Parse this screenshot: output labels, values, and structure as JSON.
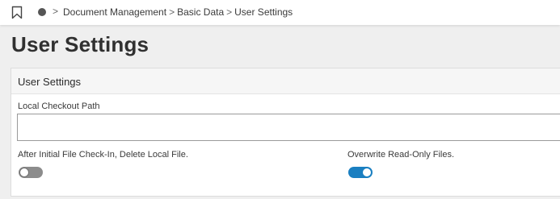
{
  "breadcrumb": {
    "items": [
      "Document Management",
      "Basic Data",
      "User Settings"
    ],
    "separator": ">"
  },
  "page": {
    "title": "User Settings"
  },
  "panel": {
    "title": "User Settings",
    "checkout_path": {
      "label": "Local Checkout Path",
      "value": "",
      "placeholder": ""
    },
    "delete_local_file": {
      "label": "After Initial File Check-In, Delete Local File.",
      "enabled": false
    },
    "overwrite_readonly": {
      "label": "Overwrite Read-Only Files.",
      "enabled": true
    }
  },
  "colors": {
    "toggle_on": "#1a7fc1",
    "toggle_off": "#8c8c8c"
  },
  "icons": {
    "bookmark": "bookmark-icon",
    "home": "home-dot-icon",
    "separator": "chevron-right-icon"
  }
}
